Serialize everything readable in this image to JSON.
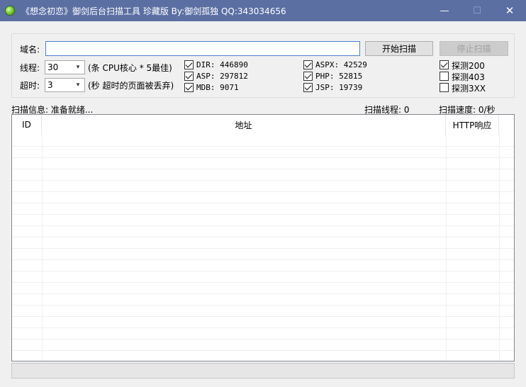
{
  "window": {
    "title": "《想念初恋》御剑后台扫描工具 珍藏版 By:御剑孤独 QQ:343034656",
    "minimize": "—",
    "maximize": "☐",
    "close": "✕"
  },
  "form": {
    "domain_label": "域名:",
    "domain_value": "",
    "start_button": "开始扫描",
    "stop_button": "停止扫描",
    "threads_label": "线程:",
    "threads_value": "30",
    "threads_hint": "(条 CPU核心 * 5最佳)",
    "timeout_label": "超时:",
    "timeout_value": "3",
    "timeout_hint": "(秒 超时的页面被丢弃)"
  },
  "dictionaries": [
    {
      "label": "DIR: 446890",
      "checked": true
    },
    {
      "label": "ASP: 297812",
      "checked": true
    },
    {
      "label": "MDB: 9071",
      "checked": true
    },
    {
      "label": "ASPX: 42529",
      "checked": true
    },
    {
      "label": "PHP: 52815",
      "checked": true
    },
    {
      "label": "JSP: 19739",
      "checked": true
    }
  ],
  "probes": [
    {
      "label": "探测200",
      "checked": true
    },
    {
      "label": "探测403",
      "checked": false
    },
    {
      "label": "探测3XX",
      "checked": false
    }
  ],
  "status": {
    "info": "扫描信息: 准备就绪...",
    "threads": "扫描线程: 0",
    "speed": "扫描速度: 0/秒"
  },
  "table": {
    "columns": [
      "ID",
      "地址",
      "HTTP响应"
    ],
    "rows": []
  }
}
